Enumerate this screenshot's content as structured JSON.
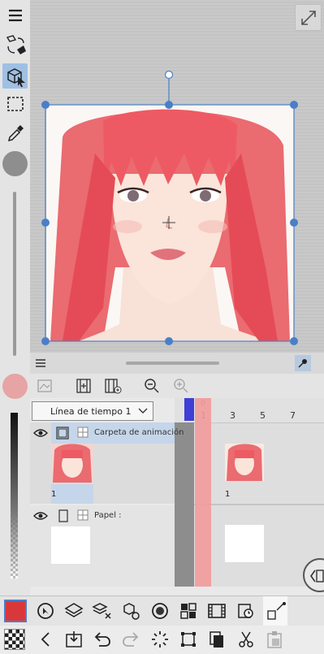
{
  "timeline": {
    "name": "Línea de tiempo 1",
    "frame_numbers": [
      "1",
      "3",
      "5",
      "7"
    ],
    "current_frame": "0",
    "layers": [
      {
        "name": "Carpeta de animación",
        "frame_label": "1"
      },
      {
        "name": "Papel :"
      }
    ],
    "cel_label": "1"
  },
  "colors": {
    "main_color": "#d9383a",
    "sub_color": "#e7a4a4",
    "accent": "#4a7fc8",
    "playhead": "#f29a9a",
    "current_marker": "#3f3fd6"
  },
  "icons": {
    "left": [
      "menu-icon",
      "swap-tool-icon",
      "object-select-icon",
      "selection-rect-icon",
      "eyedropper-icon",
      "brush-size-icon",
      "main-color-swatch",
      "sub-color-swatch"
    ],
    "bottom_row1": [
      "color-swatch",
      "operation-icon",
      "layers-icon",
      "layer-settings-icon",
      "sub-tool-settings-icon",
      "navigator-icon",
      "material-icon",
      "animation-icon",
      "timeline-icon",
      "edit-icon"
    ],
    "bottom_row2": [
      "transparent-color-icon",
      "back-icon",
      "import-icon",
      "undo-icon",
      "redo-icon",
      "loading-icon",
      "transform-icon",
      "copy-icon",
      "cut-icon",
      "paste-icon"
    ]
  }
}
